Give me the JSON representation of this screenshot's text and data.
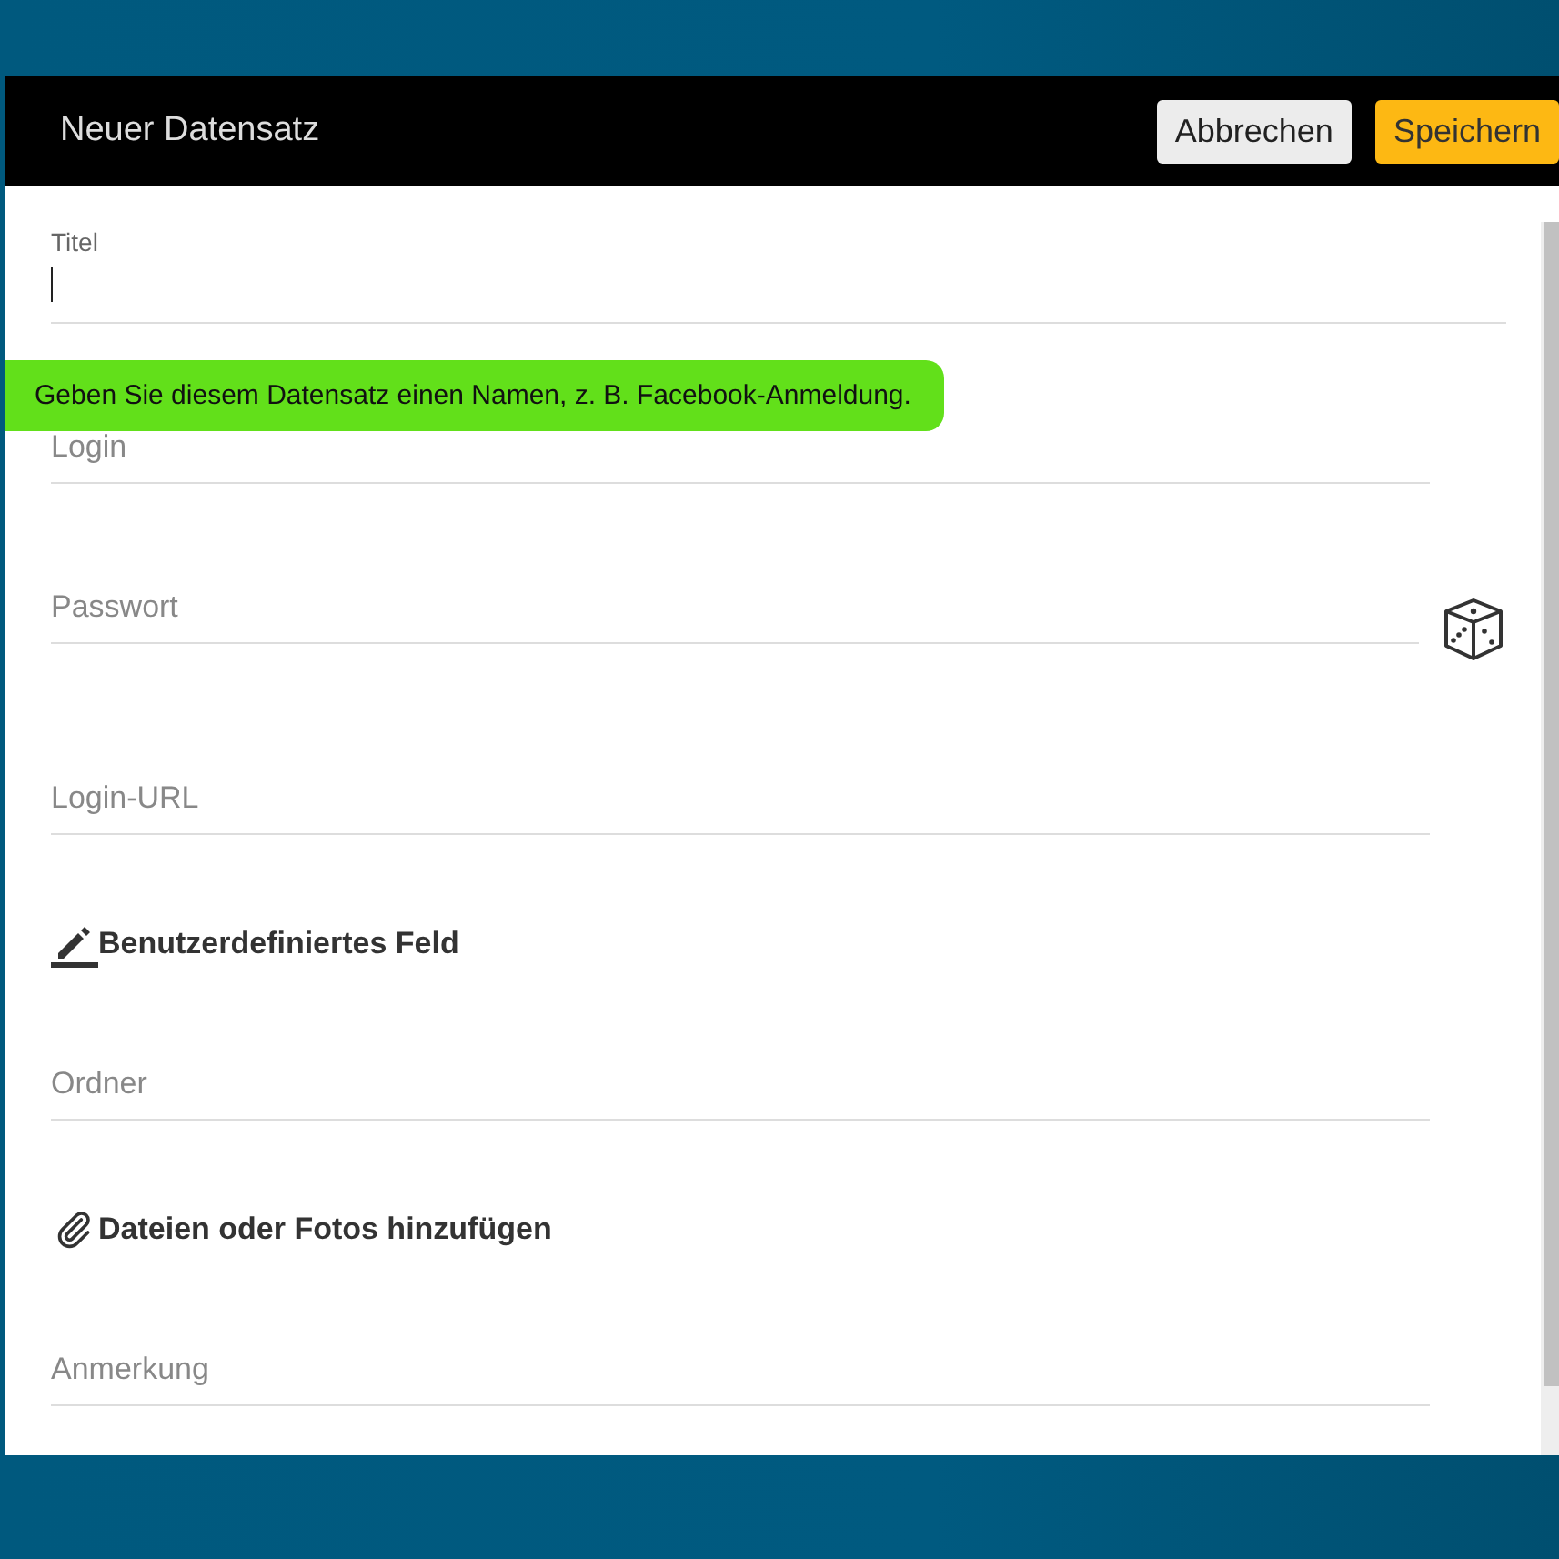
{
  "dialog": {
    "title": "Neuer Datensatz",
    "buttons": [
      {
        "label": "Abbrechen",
        "kind": "cancel"
      },
      {
        "label": "Speichern",
        "kind": "save"
      }
    ]
  },
  "form": [
    {
      "kind": "field",
      "label": "Titel",
      "focused": true
    },
    {
      "kind": "field",
      "label": "Login",
      "focused": false
    },
    {
      "kind": "password",
      "label": "Passwort",
      "focused": false
    },
    {
      "kind": "field",
      "label": "Login-URL",
      "focused": false
    },
    {
      "kind": "custom-field",
      "label": "Benutzerdefiniertes Feld"
    },
    {
      "kind": "field",
      "label": "Ordner",
      "focused": false
    },
    {
      "kind": "attachment",
      "label": "Dateien oder Fotos hinzufügen"
    },
    {
      "kind": "field",
      "label": "Anmerkung",
      "focused": false
    }
  ],
  "tooltip": {
    "text": "Geben Sie diesem Datensatz einen Namen, z. B. Facebook-Anmeldung."
  }
}
